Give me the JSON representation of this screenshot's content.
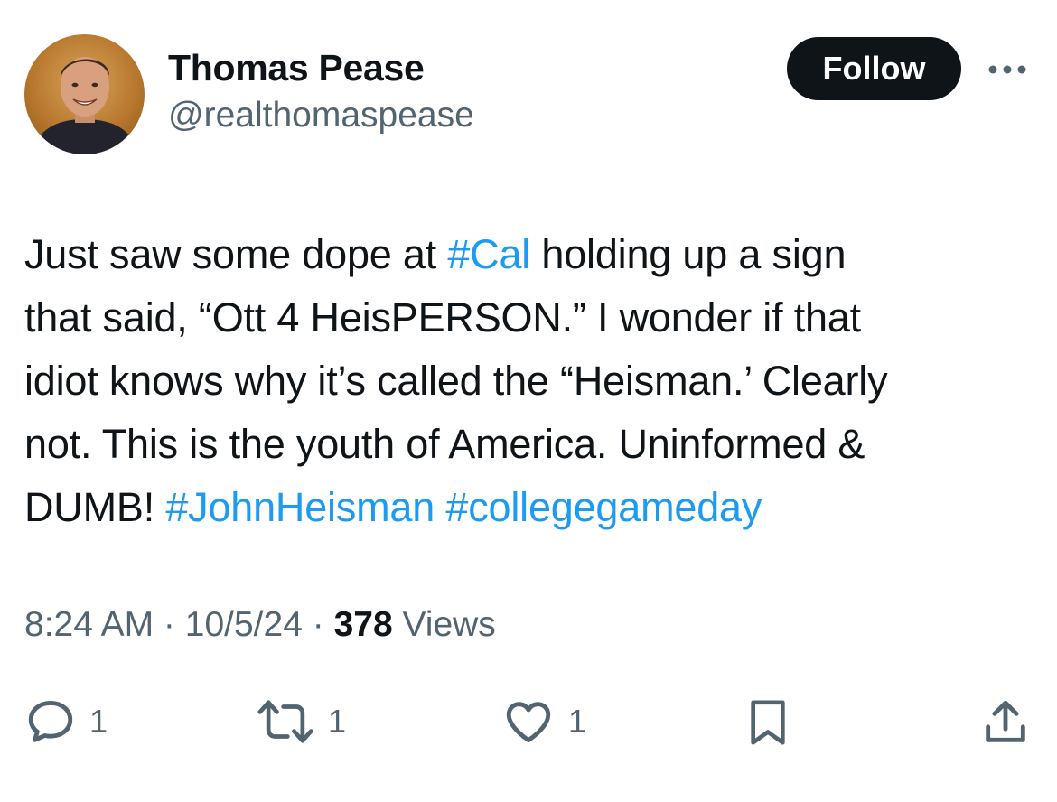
{
  "author": {
    "name": "Thomas Pease",
    "handle": "@realthomaspease"
  },
  "follow_label": "Follow",
  "more_icon": "more-horizontal-icon",
  "tweet": {
    "lines": [
      [
        {
          "text": "Just saw some dope at ",
          "type": "text"
        },
        {
          "text": "#Cal",
          "type": "hashtag"
        },
        {
          "text": " holding up a sign",
          "type": "text"
        }
      ],
      [
        {
          "text": "that said, “Ott 4 HeisPERSON.” I wonder if that",
          "type": "text"
        }
      ],
      [
        {
          "text": "idiot knows why it’s called the “Heisman.’ Clearly",
          "type": "text"
        }
      ],
      [
        {
          "text": "not. This is the youth of America. Uninformed &",
          "type": "text"
        }
      ],
      [
        {
          "text": "DUMB! ",
          "type": "text"
        },
        {
          "text": "#JohnHeisman",
          "type": "hashtag"
        },
        {
          "text": " ",
          "type": "text"
        },
        {
          "text": "#collegegameday",
          "type": "hashtag"
        }
      ]
    ]
  },
  "meta": {
    "time": "8:24 AM",
    "separator": " · ",
    "date": "10/5/24",
    "views_count": "378",
    "views_label": " Views"
  },
  "actions": {
    "reply": {
      "count": "1",
      "icon": "reply-icon"
    },
    "retweet": {
      "count": "1",
      "icon": "retweet-icon"
    },
    "like": {
      "count": "1",
      "icon": "heart-icon"
    },
    "bookmark": {
      "icon": "bookmark-icon"
    },
    "share": {
      "icon": "share-icon"
    }
  },
  "colors": {
    "text": "#0f1419",
    "secondary": "#536471",
    "link": "#1d9bf0",
    "button_bg": "#0f1419"
  }
}
